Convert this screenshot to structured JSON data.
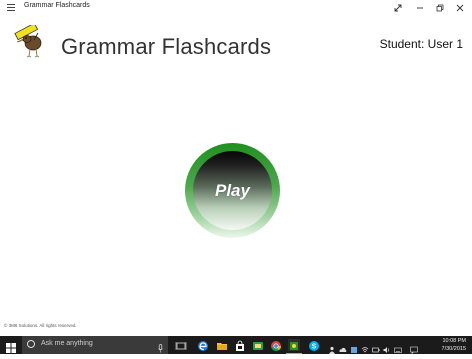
{
  "window": {
    "title": "Grammar Flashcards",
    "menu_icon": "hamburger-icon",
    "controls": [
      "resize-icon",
      "minimize-icon",
      "maximize-icon",
      "close-icon"
    ]
  },
  "header": {
    "logo_icon": "kiwi-bird-mascot-icon",
    "title": "Grammar Flashcards",
    "student_label": "Student:",
    "student_name": "User 1"
  },
  "main": {
    "play_label": "Play",
    "play_color": "#2f9b2f"
  },
  "footer": {
    "copyright": "© 3M6 Solutions. All rights reserved."
  },
  "taskbar": {
    "search_placeholder": "Ask me anything",
    "apps": [
      "task-view-icon",
      "edge-icon",
      "file-explorer-icon",
      "store-icon",
      "app-icon",
      "chrome-icon",
      "photoshop-icon",
      "grammar-flashcards-icon",
      "skype-icon"
    ],
    "tray": [
      "people-icon",
      "cloud-icon",
      "onedrive-icon",
      "network-icon",
      "battery-icon",
      "volume-icon",
      "keyboard-icon",
      "message-icon"
    ],
    "time": "10:08 PM",
    "date": "7/30/2015"
  }
}
